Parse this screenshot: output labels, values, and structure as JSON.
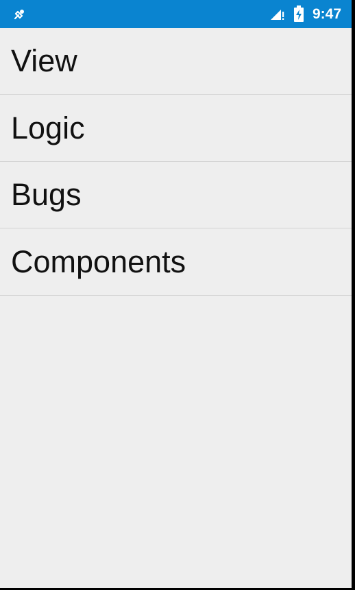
{
  "status_bar": {
    "time": "9:47",
    "background_color": "#0a84d0",
    "left_icon": "usb-debug-icon",
    "signal_icon": "cell-signal-icon",
    "battery_icon": "battery-charging-icon"
  },
  "menu": {
    "items": [
      {
        "label": "View"
      },
      {
        "label": "Logic"
      },
      {
        "label": "Bugs"
      },
      {
        "label": "Components"
      }
    ]
  },
  "colors": {
    "background": "#eeeeee",
    "divider": "#d2d2d2",
    "text": "#111111"
  }
}
